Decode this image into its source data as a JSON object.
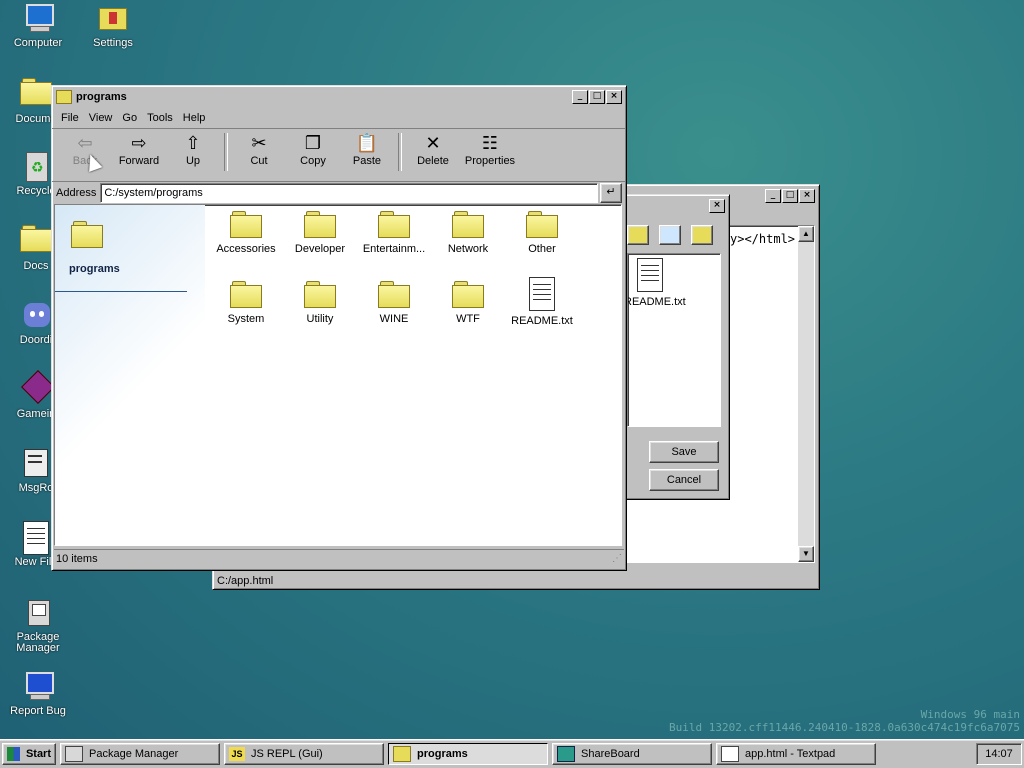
{
  "desktop": {
    "icons": [
      {
        "label": "Computer",
        "icon": "computer-icon"
      },
      {
        "label": "Settings",
        "icon": "settings-icon"
      },
      {
        "label": "Docume",
        "icon": "folder-icon"
      },
      {
        "label": "Recycle",
        "icon": "recycle-bin-icon"
      },
      {
        "label": "Docs",
        "icon": "folder-icon"
      },
      {
        "label": "Doordi",
        "icon": "discord-icon"
      },
      {
        "label": "Gamein",
        "icon": "game-icon"
      },
      {
        "label": "MsgRo",
        "icon": "msgroom-icon"
      },
      {
        "label": "New File",
        "icon": "new-file-icon"
      },
      {
        "label": "Package Manager",
        "icon": "package-manager-icon"
      },
      {
        "label": "Report Bug",
        "icon": "report-bug-icon"
      }
    ],
    "watermark_line1": "Windows 96 main",
    "watermark_line2": "Build 13202.cff11446.240410-1828.0a630c474c19fc6a7075"
  },
  "explorer": {
    "title": "programs",
    "menu": [
      "File",
      "View",
      "Go",
      "Tools",
      "Help"
    ],
    "toolbar": {
      "back": "Back",
      "forward": "Forward",
      "up": "Up",
      "cut": "Cut",
      "copy": "Copy",
      "paste": "Paste",
      "delete": "Delete",
      "properties": "Properties"
    },
    "address_label": "Address",
    "address_value": "C:/system/programs",
    "side_title": "programs",
    "items": [
      {
        "label": "Accessories",
        "type": "folder"
      },
      {
        "label": "Developer",
        "type": "folder"
      },
      {
        "label": "Entertainm...",
        "type": "folder"
      },
      {
        "label": "Network",
        "type": "folder"
      },
      {
        "label": "Other",
        "type": "folder"
      },
      {
        "label": "System",
        "type": "folder"
      },
      {
        "label": "Utility",
        "type": "folder"
      },
      {
        "label": "WINE",
        "type": "folder"
      },
      {
        "label": "WTF",
        "type": "folder"
      },
      {
        "label": "README.txt",
        "type": "file"
      }
    ],
    "status": "10 items"
  },
  "textpad": {
    "code_snippet": "y></html>",
    "status_path": "C:/app.html"
  },
  "dialog": {
    "file_label": "README.txt",
    "save": "Save",
    "cancel": "Cancel"
  },
  "taskbar": {
    "start": "Start",
    "tasks": [
      {
        "label": "Package Manager",
        "pressed": false
      },
      {
        "label": "JS REPL (Gui)",
        "pressed": false
      },
      {
        "label": "programs",
        "pressed": true
      },
      {
        "label": "ShareBoard",
        "pressed": false
      },
      {
        "label": "app.html - Textpad",
        "pressed": false
      }
    ],
    "clock": "14:07"
  },
  "colors": {
    "desktop": "#2c7a84",
    "window": "#c0c0c0",
    "folder": "#e6dc5a"
  }
}
